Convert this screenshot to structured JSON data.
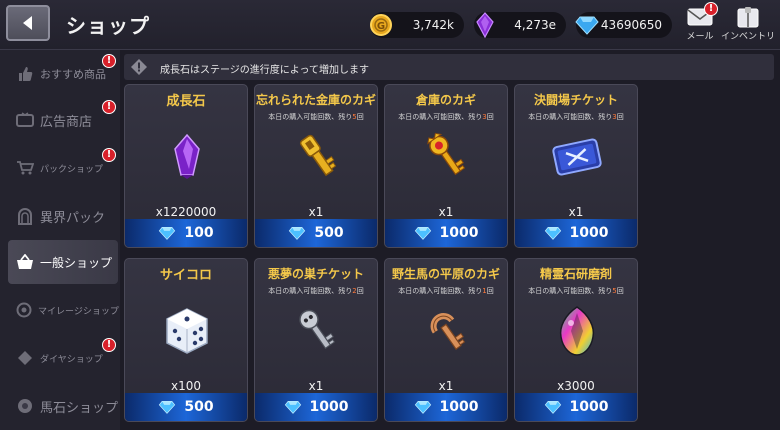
{
  "header": {
    "title": "ショップ",
    "back_icon": "back-arrow-icon",
    "currencies": [
      {
        "icon": "gold-coin-icon",
        "value": "3,742k"
      },
      {
        "icon": "purple-gem-icon",
        "value": "4,273e"
      },
      {
        "icon": "diamond-icon",
        "value": "43690650"
      }
    ],
    "mail_label": "メール",
    "inventory_label": "インベントリ",
    "badge_mark": "!"
  },
  "sidebar": {
    "items": [
      {
        "label": "おすすめ商品",
        "icon": "thumbs-up-icon",
        "badge": true
      },
      {
        "label": "広告商店",
        "icon": "tv-icon",
        "badge": true
      },
      {
        "label": "パックショップ",
        "icon": "cart-icon",
        "badge": true
      },
      {
        "label": "異界パック",
        "icon": "portal-icon",
        "badge": false
      },
      {
        "label": "一般ショップ",
        "icon": "basket-icon",
        "badge": false,
        "active": true
      },
      {
        "label": "マイレージショップ",
        "icon": "mileage-icon",
        "badge": false
      },
      {
        "label": "ダイヤショップ",
        "icon": "diamond-shop-icon",
        "badge": true
      },
      {
        "label": "馬石ショップ",
        "icon": "horse-stone-icon",
        "badge": false
      }
    ]
  },
  "info": {
    "icon": "warning-icon",
    "text": "成長石はステージの進行度によって増加します"
  },
  "shop": {
    "limit_prefix": "本日の購入可能回数、残り",
    "limit_suffix": "回",
    "items": [
      {
        "name": "成長石",
        "art": "purple-crystal-icon",
        "qty": "x1220000",
        "price": "100",
        "limit": null
      },
      {
        "name": "忘れられた金庫のカギ",
        "art": "gold-key-icon",
        "qty": "x1",
        "price": "500",
        "limit": "5"
      },
      {
        "name": "倉庫のカギ",
        "art": "crown-key-icon",
        "qty": "x1",
        "price": "1000",
        "limit": "3"
      },
      {
        "name": "決闘場チケット",
        "art": "duel-ticket-icon",
        "qty": "x1",
        "price": "1000",
        "limit": "3"
      },
      {
        "name": "サイコロ",
        "art": "dice-icon",
        "qty": "x100",
        "price": "500",
        "limit": null
      },
      {
        "name": "悪夢の巣チケット",
        "art": "silver-key-icon",
        "qty": "x1",
        "price": "1000",
        "limit": "2"
      },
      {
        "name": "野生馬の平原のカギ",
        "art": "horseshoe-key-icon",
        "qty": "x1",
        "price": "1000",
        "limit": "1"
      },
      {
        "name": "精霊石研磨剤",
        "art": "rainbow-gem-icon",
        "qty": "x3000",
        "price": "1000",
        "limit": "5"
      }
    ]
  },
  "colors": {
    "accent_gold": "#f4c84a",
    "price_blue": "#1d66d8",
    "badge_red": "#d8202a",
    "limit_orange": "#ff7a3a"
  }
}
